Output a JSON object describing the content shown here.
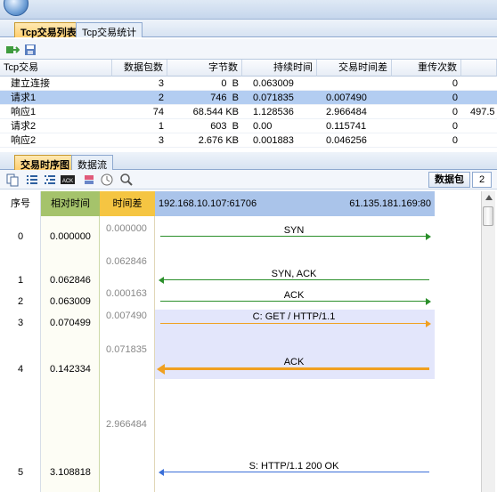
{
  "top_tabs": [
    {
      "label": "Tcp交易列表",
      "active": true
    },
    {
      "label": "Tcp交易统计",
      "active": false
    }
  ],
  "grid": {
    "columns": [
      "Tcp交易",
      "数据包数",
      "字节数",
      "持续时间",
      "交易时间差",
      "重传次数"
    ],
    "rows": [
      {
        "name": "建立连接",
        "packets": "3",
        "bytes": "0  B",
        "duration": "0.063009",
        "delta": "",
        "retrans": "0",
        "extra": ""
      },
      {
        "name": "请求1",
        "packets": "2",
        "bytes": "746  B",
        "duration": "0.071835",
        "delta": "0.007490",
        "retrans": "0",
        "extra": ""
      },
      {
        "name": "响应1",
        "packets": "74",
        "bytes": "68.544 KB",
        "duration": "1.128536",
        "delta": "2.966484",
        "retrans": "0",
        "extra": "497.5"
      },
      {
        "name": "请求2",
        "packets": "1",
        "bytes": "603  B",
        "duration": "0.00",
        "delta": "0.115741",
        "retrans": "0",
        "extra": ""
      },
      {
        "name": "响应2",
        "packets": "3",
        "bytes": "2.676 KB",
        "duration": "0.001883",
        "delta": "0.046256",
        "retrans": "0",
        "extra": ""
      }
    ]
  },
  "bottom_tabs": [
    {
      "label": "交易时序图",
      "active": true
    },
    {
      "label": "数据流",
      "active": false
    }
  ],
  "toolbar2": {
    "packet_label": "数据包",
    "packet_count": "2"
  },
  "sequence": {
    "headers": {
      "num": "序号",
      "rel": "相对时间",
      "delta": "时间差"
    },
    "left_endpoint": "192.168.10.107:61706",
    "right_endpoint": "61.135.181.169:80",
    "packets": [
      {
        "num": "0",
        "rel": "0.000000",
        "msg": "SYN",
        "dir": "right"
      },
      {
        "num": "1",
        "rel": "0.062846",
        "msg": "SYN, ACK",
        "dir": "left"
      },
      {
        "num": "2",
        "rel": "0.063009",
        "msg": "ACK",
        "dir": "right"
      },
      {
        "num": "3",
        "rel": "0.070499",
        "msg": "C: GET / HTTP/1.1",
        "dir": "right"
      },
      {
        "num": "4",
        "rel": "0.142334",
        "msg": "ACK",
        "dir": "left"
      },
      {
        "num": "5",
        "rel": "3.108818",
        "msg": "S: HTTP/1.1 200 OK",
        "dir": "left"
      }
    ],
    "deltas": [
      "0.000000",
      "0.062846",
      "0.000163",
      "0.007490",
      "0.071835",
      "2.966484"
    ]
  },
  "colors": {
    "green": "#2a8f2a",
    "orange": "#f0a020",
    "blue": "#3a6fd8",
    "highlight": "#e3e6fb"
  }
}
